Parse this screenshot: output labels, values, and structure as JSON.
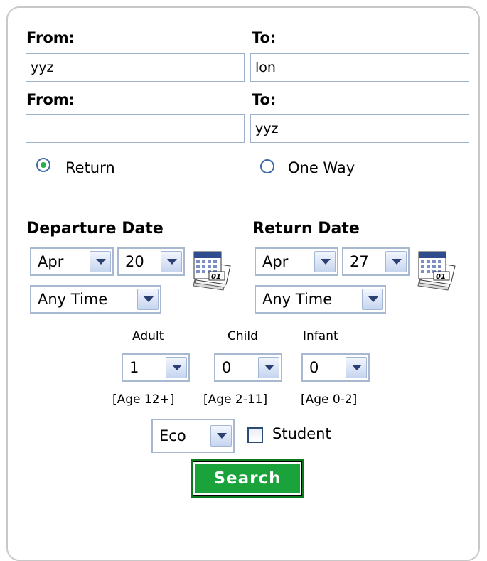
{
  "search": {
    "row1": {
      "from_label": "From:",
      "to_label": "To:",
      "from_value": "yyz",
      "to_value": "lon"
    },
    "row2": {
      "from_label": "From:",
      "to_label": "To:",
      "from_value": "",
      "to_value": "yyz"
    },
    "trip_type": {
      "return_label": "Return",
      "one_way_label": "One Way",
      "selected": "Return"
    },
    "departure": {
      "heading": "Departure Date",
      "month": "Apr",
      "day": "20",
      "time": "Any Time",
      "calendar_icon": "calendar-icon"
    },
    "return": {
      "heading": "Return Date",
      "month": "Apr",
      "day": "27",
      "time": "Any Time",
      "calendar_icon": "calendar-icon"
    },
    "passengers": {
      "adult_label": "Adult",
      "child_label": "Child",
      "infant_label": "Infant",
      "adult_value": "1",
      "child_value": "0",
      "infant_value": "0",
      "adult_age": "[Age 12+]",
      "child_age": "[Age 2-11]",
      "infant_age": "[Age 0-2]"
    },
    "cabin": {
      "value": "Eco",
      "student_label": "Student",
      "student_checked": false
    },
    "search_button": "Search"
  },
  "colors": {
    "button_green": "#19a33a",
    "button_border": "#0b7a1f",
    "radio_selected": "#23b14d"
  }
}
